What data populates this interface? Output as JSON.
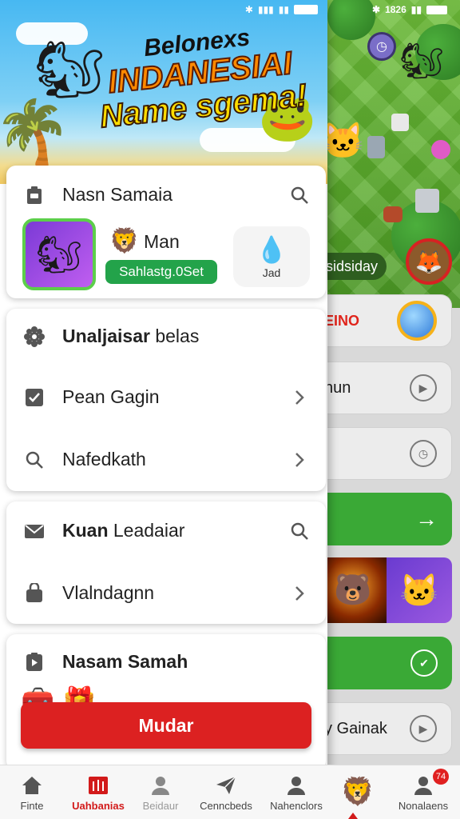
{
  "status_bar": {
    "left_sheet": "",
    "right_time": "1826",
    "right_icons": "✱ ▮▮"
  },
  "hero": {
    "line1": "Belonexs",
    "line2": "INDANESIAI",
    "line3": "Name sgema!"
  },
  "card1": {
    "title": "Nasn Samaia",
    "user_label": "Man",
    "pill_text": "Sahlastg.0Set",
    "side_label": "Jad"
  },
  "card2": {
    "header": {
      "bold": "Unaljaisar",
      "rest": " belas"
    },
    "items": [
      {
        "label": "Pean Gagin"
      },
      {
        "label": "Nafedkath"
      }
    ]
  },
  "card3": {
    "header": {
      "bold": "Kuan",
      "rest": " Leadaiar"
    },
    "items": [
      {
        "label": "Vlalndagnn"
      }
    ]
  },
  "card4": {
    "header": "Nasam Samah",
    "button_label": "Mudar"
  },
  "background_panel": {
    "game_pill": "sidsiday",
    "row_eino": "EINO",
    "row_nun": "nun",
    "row_gainak": "y Gainak",
    "row_green_icon": "สี"
  },
  "bottom_nav": {
    "items": [
      {
        "label": "Finte"
      },
      {
        "label": "Uahbanias"
      },
      {
        "label": "Beidaur"
      },
      {
        "label": "Cenncbeds"
      },
      {
        "label": "Nahenclors"
      },
      {
        "label": ""
      },
      {
        "label": "Nonalaens"
      }
    ],
    "badge": "74"
  },
  "colors": {
    "accent_red": "#dc2121",
    "accent_green": "#23a34a",
    "sheet_bg": "#ffffff"
  }
}
